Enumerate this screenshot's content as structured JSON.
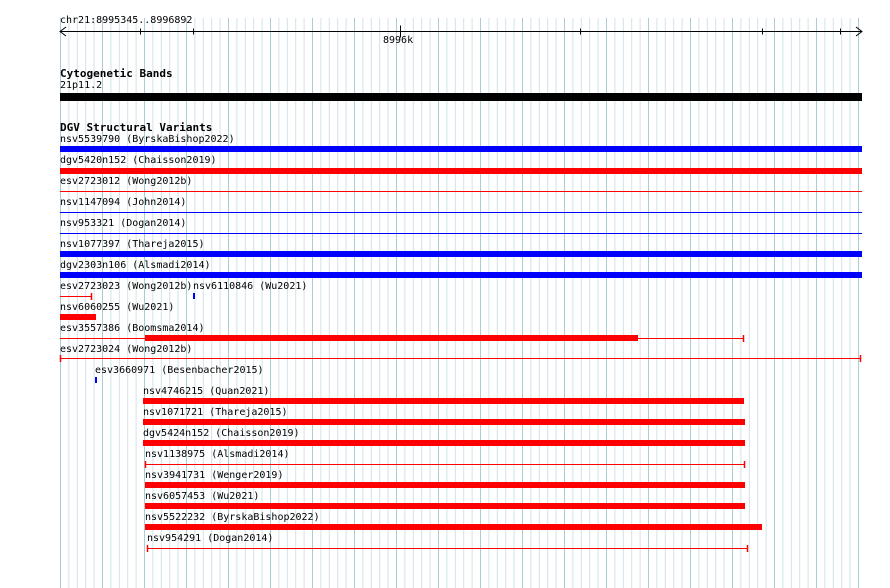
{
  "ruler": {
    "range_label": "chr21:8995345..8996892",
    "tick_label": "8996k"
  },
  "cytobands": {
    "title": "Cytogenetic Bands",
    "band_label": "21p11.2"
  },
  "dgv": {
    "title": "DGV Structural Variants",
    "features": [
      {
        "label": "nsv5539790 (ByrskaBishop2022)",
        "color": "#0000ff",
        "style": "thick"
      },
      {
        "label": "dgv5420n152 (Chaisson2019)",
        "color": "#ff0000",
        "style": "thick"
      },
      {
        "label": "esv2723012 (Wong2012b)",
        "color": "#ff0000",
        "style": "thin"
      },
      {
        "label": "nsv1147094 (John2014)",
        "color": "#0000ff",
        "style": "thin"
      },
      {
        "label": "nsv953321 (Dogan2014)",
        "color": "#0000ff",
        "style": "thin"
      },
      {
        "label": "nsv1077397 (Thareja2015)",
        "color": "#0000ff",
        "style": "thick"
      },
      {
        "label": "dgv2303n106 (Alsmadi2014)",
        "color": "#0000ff",
        "style": "thick"
      },
      {
        "label": "esv2723023 (Wong2012b)",
        "color": "#ff0000",
        "style": "thin-capped"
      },
      {
        "label": "nsv6110846 (Wu2021)",
        "color": "#0000ff",
        "style": "tick"
      },
      {
        "label": "nsv6060255 (Wu2021)",
        "color": "#ff0000",
        "style": "thick"
      },
      {
        "label": "esv3557386 (Boomsma2014)",
        "color": "#ff0000",
        "style": "mixed"
      },
      {
        "label": "esv2723024 (Wong2012b)",
        "color": "#ff0000",
        "style": "thin-capped"
      },
      {
        "label": "esv3660971 (Besenbacher2015)",
        "color": "#0000ff",
        "style": "tick"
      },
      {
        "label": "nsv4746215 (Quan2021)",
        "color": "#ff0000",
        "style": "thick"
      },
      {
        "label": "nsv1071721 (Thareja2015)",
        "color": "#ff0000",
        "style": "thick"
      },
      {
        "label": "dgv5424n152 (Chaisson2019)",
        "color": "#ff0000",
        "style": "thick"
      },
      {
        "label": "nsv1138975 (Alsmadi2014)",
        "color": "#ff0000",
        "style": "thin-capped"
      },
      {
        "label": "nsv3941731 (Wenger2019)",
        "color": "#ff0000",
        "style": "thick"
      },
      {
        "label": "nsv6057453 (Wu2021)",
        "color": "#ff0000",
        "style": "thick"
      },
      {
        "label": "nsv5522232 (ByrskaBishop2022)",
        "color": "#ff0000",
        "style": "thick"
      },
      {
        "label": "nsv954291 (Dogan2014)",
        "color": "#ff0000",
        "style": "thin-capped"
      }
    ]
  }
}
